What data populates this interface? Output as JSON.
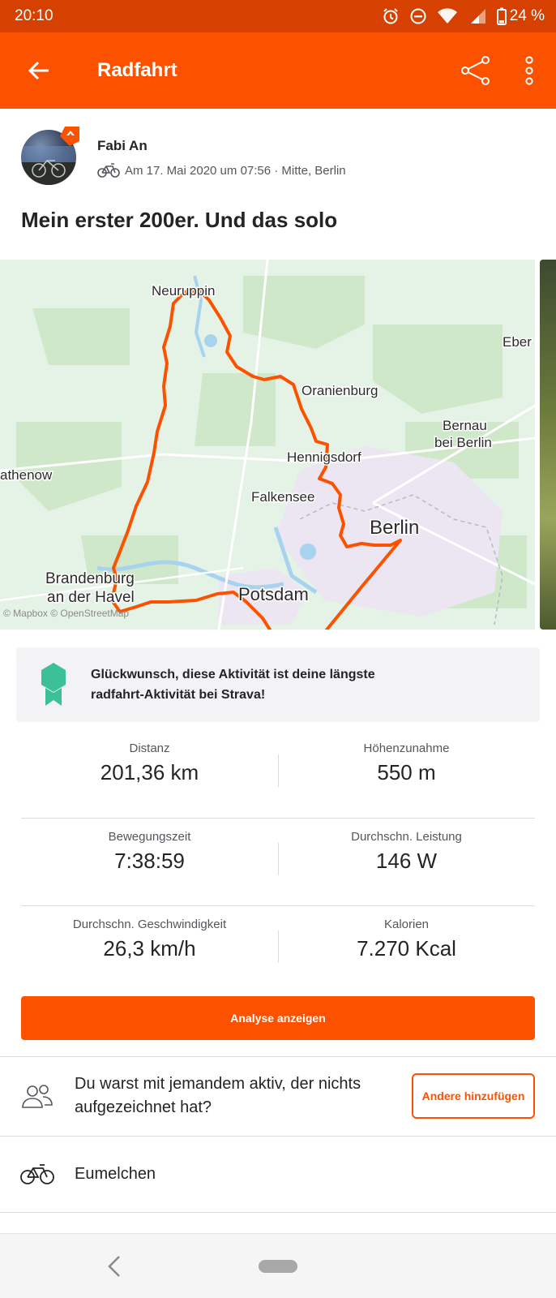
{
  "status_bar": {
    "time": "20:10",
    "battery": "24 %",
    "icons": [
      "alarm-icon",
      "do-not-disturb-icon",
      "wifi-icon",
      "signal-icon",
      "battery-icon"
    ]
  },
  "app_bar": {
    "title": "Radfahrt",
    "icons": [
      "back-arrow-icon",
      "share-icon",
      "more-vertical-icon"
    ]
  },
  "athlete": {
    "name": "Fabi An",
    "meta": "Am 17. Mai 2020 um 07:56 · Mitte, Berlin",
    "activity_icon": "bike-icon"
  },
  "activity": {
    "title": "Mein erster 200er. Und das solo"
  },
  "map": {
    "labels": {
      "neuruppin": "Neuruppin",
      "eber": "Eber",
      "oranienburg": "Oranienburg",
      "bernau": "Bernau",
      "bernau2": "bei Berlin",
      "rathenow": "athenow",
      "hennigsdorf": "Hennigsdorf",
      "falkensee": "Falkensee",
      "berlin": "Berlin",
      "brandenburg": "Brandenburg",
      "brandenburg2": "an der Havel",
      "potsdam": "Potsdam",
      "attribution": "© Mapbox © OpenStreetMap"
    },
    "route_color": "#fc5200"
  },
  "achievement": {
    "line1": "Glückwunsch, diese Aktivität ist deine längste",
    "line2": "radfahrt-Aktivität bei Strava!",
    "medal_color": "#3cc196"
  },
  "stats": [
    [
      {
        "label": "Distanz",
        "value": "201,36 km"
      },
      {
        "label": "Höhenzunahme",
        "value": "550 m"
      }
    ],
    [
      {
        "label": "Bewegungszeit",
        "value": "7:38:59"
      },
      {
        "label": "Durchschn. Leistung",
        "value": "146 W"
      }
    ],
    [
      {
        "label": "Durchschn. Geschwindigkeit",
        "value": "26,3 km/h"
      },
      {
        "label": "Kalorien",
        "value": "7.270 Kcal"
      }
    ]
  ],
  "analyse_button": "Analyse anzeigen",
  "together": {
    "text": "Du warst mit jemandem aktiv, der nichts aufgezeichnet hat?",
    "button": "Andere hinzufügen"
  },
  "gear": {
    "name": "Eumelchen"
  },
  "colors": {
    "brand": "#fc5200",
    "status_bar": "#d64000"
  }
}
